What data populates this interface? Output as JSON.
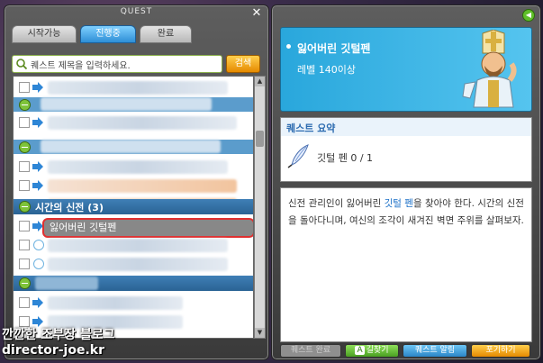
{
  "left_window": {
    "title": "QUEST",
    "tabs": [
      {
        "label": "시작가능",
        "active": false
      },
      {
        "label": "진행중",
        "active": true
      },
      {
        "label": "완료",
        "active": false
      }
    ],
    "search": {
      "placeholder": "퀘스트 제목을 입력하세요.",
      "button_label": "검색"
    },
    "group": {
      "label": "시간의 신전 (3)"
    },
    "selected_quest": {
      "label": "잃어버린 깃털펜"
    }
  },
  "right_window": {
    "quest_title": "잃어버린 깃털펜",
    "level": "레벨 140이상",
    "summary": {
      "header": "퀘스트 요약",
      "item_text": "깃털 펜 0 / 1"
    },
    "description": {
      "part1": "신전 관리인이 잃어버린 ",
      "highlight": "깃털 펜",
      "part2": "을 찾아야 한다. 시간의 신전을 돌아다니며, 여신의 조각이 새겨진 벽면 주위를 살펴보자."
    },
    "buttons": {
      "complete": "퀘스트 완료",
      "find_path": "길찾기",
      "alarm": "퀘스트 알림",
      "give_up": "포기하기",
      "hotkey": "A"
    }
  },
  "watermark": {
    "line1": "깐깐한 조부장 블로그",
    "line2": "director-joe.kr"
  },
  "colors": {
    "accent_blue": "#2a6394",
    "selection_red": "#e03030",
    "info_blue": "#29a7dc"
  }
}
